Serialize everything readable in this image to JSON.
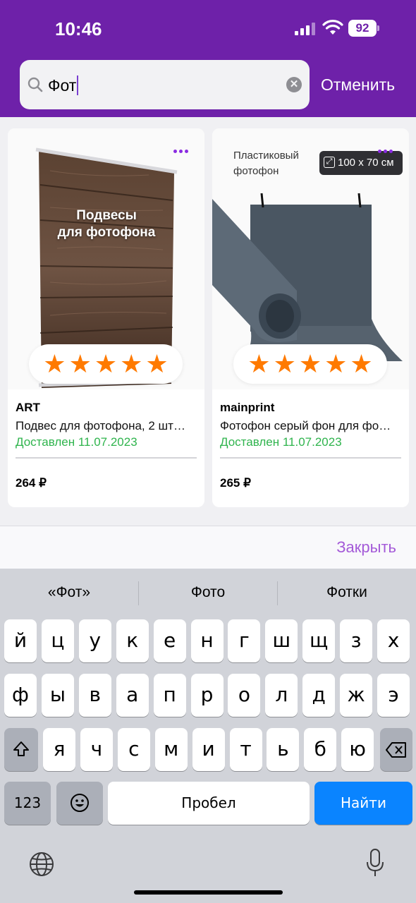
{
  "status_bar": {
    "time": "10:46",
    "battery": "92"
  },
  "search": {
    "query": "Фот",
    "cancel_label": "Отменить"
  },
  "products": [
    {
      "image_caption": "Подвесы\nдля фотофона",
      "brand": "ART",
      "title": "Подвес для фотофона, 2 шт…",
      "status": "Доставлен 11.07.2023",
      "price": "264 ₽",
      "rating_stars": 5
    },
    {
      "image_caption": "Пластиковый\nфотофон",
      "image_badge": "100 x 70 см",
      "brand": "mainprint",
      "title": "Фотофон серый фон для фо…",
      "status": "Доставлен 11.07.2023",
      "price": "265 ₽",
      "rating_stars": 5
    }
  ],
  "close_label": "Закрыть",
  "keyboard": {
    "suggestions": [
      "«Фот»",
      "Фото",
      "Фотки"
    ],
    "row1": [
      "й",
      "ц",
      "у",
      "к",
      "е",
      "н",
      "г",
      "ш",
      "щ",
      "з",
      "х"
    ],
    "row2": [
      "ф",
      "ы",
      "в",
      "а",
      "п",
      "р",
      "о",
      "л",
      "д",
      "ж",
      "э"
    ],
    "row3": [
      "я",
      "ч",
      "с",
      "м",
      "и",
      "т",
      "ь",
      "б",
      "ю"
    ],
    "numbers_label": "123",
    "space_label": "Пробел",
    "go_label": "Найти"
  },
  "colors": {
    "brand_purple": "#6e21a9",
    "star_orange": "#ff7a00",
    "delivered_green": "#2fb44d",
    "accent_blue": "#0a84ff"
  }
}
